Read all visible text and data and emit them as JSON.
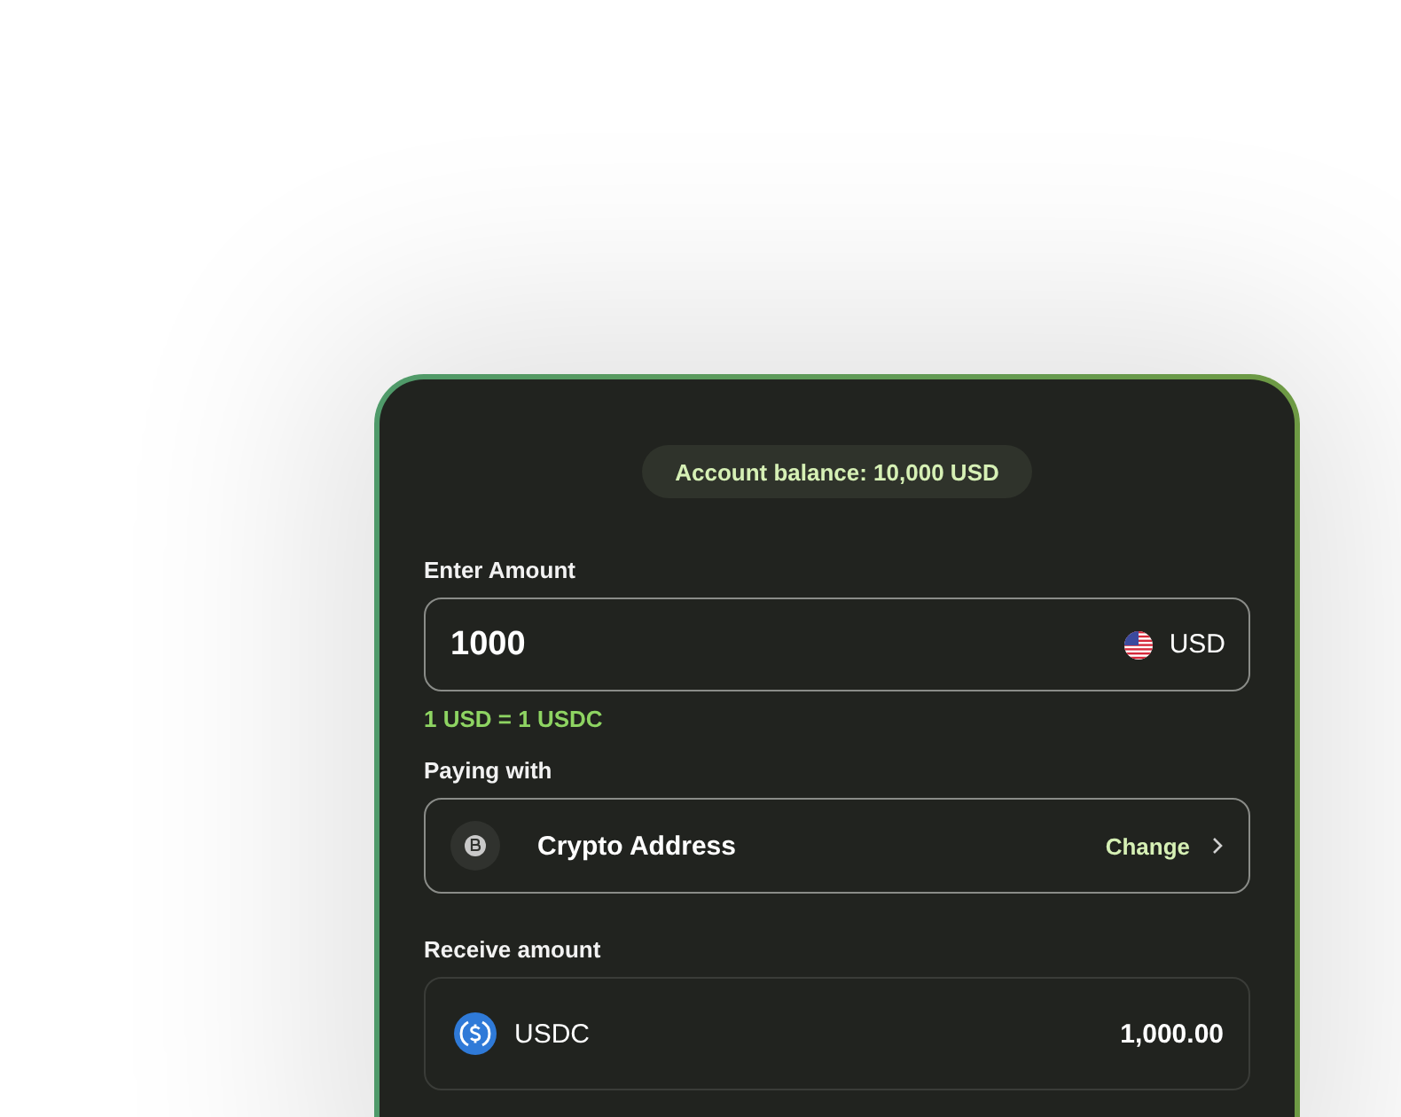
{
  "balance": "Account balance: 10,000 USD",
  "amount": {
    "label": "Enter Amount",
    "value": "1000",
    "currency": "USD"
  },
  "rate": "1 USD = 1 USDC",
  "paying": {
    "label": "Paying with",
    "method": "Crypto Address",
    "action": "Change"
  },
  "receive": {
    "label": "Receive amount",
    "token": "USDC",
    "value": "1,000.00"
  }
}
